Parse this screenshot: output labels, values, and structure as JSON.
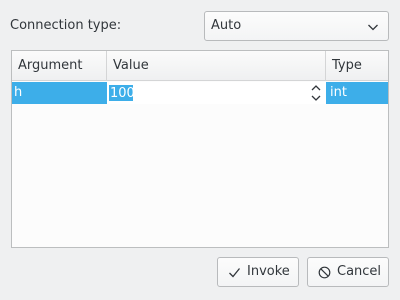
{
  "connection": {
    "label": "Connection type:",
    "selected": "Auto"
  },
  "table": {
    "headers": [
      "Argument",
      "Value",
      "Type"
    ],
    "rows": [
      {
        "argument": "h",
        "value": "100",
        "type": "int"
      }
    ]
  },
  "buttons": {
    "invoke": "Invoke",
    "cancel": "Cancel"
  },
  "colors": {
    "selection": "#3daee9",
    "window_bg": "#eff0f1"
  }
}
